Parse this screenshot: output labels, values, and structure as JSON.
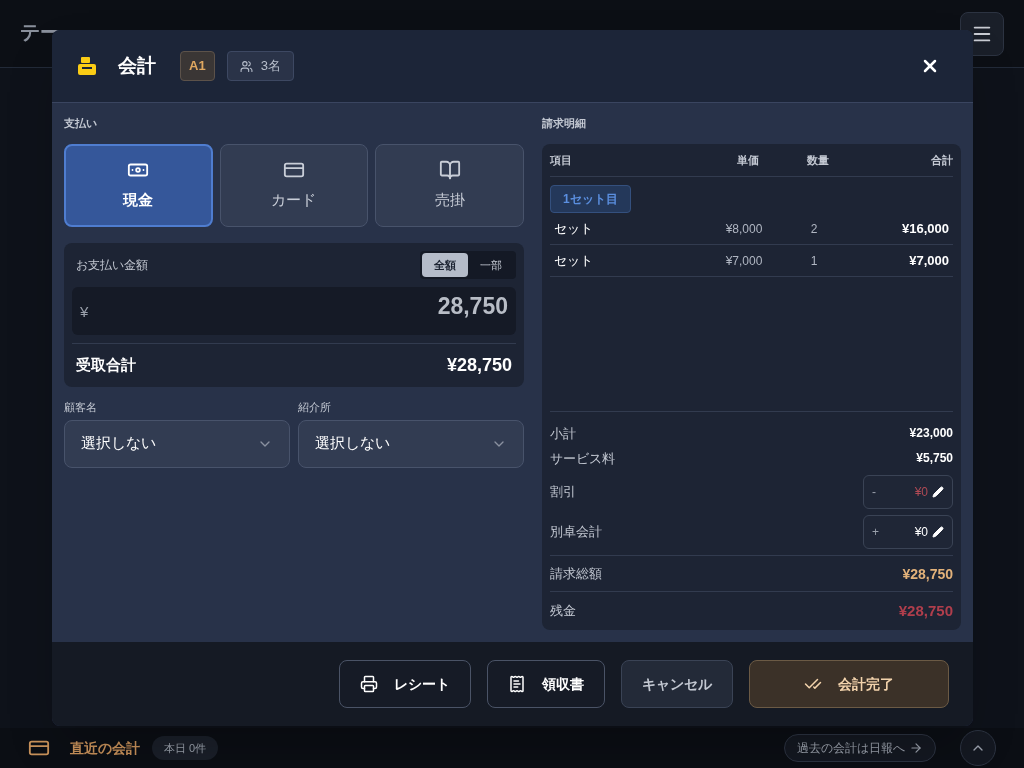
{
  "app_header": {
    "title": "テー"
  },
  "modal": {
    "title": "会計",
    "table_badge": "A1",
    "guests": "3名",
    "payment": {
      "heading": "支払い",
      "methods": [
        {
          "label": "現金",
          "kind": "cash",
          "selected": true
        },
        {
          "label": "カード",
          "kind": "card",
          "selected": false
        },
        {
          "label": "売掛",
          "kind": "credit",
          "selected": false
        }
      ],
      "amount_label": "お支払い金額",
      "amount_modes": [
        {
          "label": "全額",
          "selected": true
        },
        {
          "label": "一部",
          "selected": false
        }
      ],
      "currency": "¥",
      "amount_value": "28,750",
      "received_label": "受取合計",
      "received_value": "¥28,750"
    },
    "customer": {
      "label": "顧客名",
      "value": "選択しない"
    },
    "referrer": {
      "label": "紹介所",
      "value": "選択しない"
    },
    "bill": {
      "heading": "請求明細",
      "columns": [
        "項目",
        "単価",
        "数量",
        "合計"
      ],
      "group_tag": "1セット目",
      "rows": [
        {
          "item": "セット",
          "unit_price": "¥8,000",
          "qty": "2",
          "total": "¥16,000"
        },
        {
          "item": "セット",
          "unit_price": "¥7,000",
          "qty": "1",
          "total": "¥7,000"
        }
      ],
      "subtotal_label": "小計",
      "subtotal": "¥23,000",
      "service_label": "サービス料",
      "service": "¥5,750",
      "adjustments": [
        {
          "label": "割引",
          "sign": "-",
          "value": "¥0",
          "kind": "minus"
        },
        {
          "label": "別卓会計",
          "sign": "+",
          "value": "¥0",
          "kind": "plus"
        }
      ],
      "total_label": "請求総額",
      "total": "¥28,750",
      "balance_label": "残金",
      "balance": "¥28,750"
    },
    "buttons": [
      {
        "label": "レシート",
        "kind": "receipt"
      },
      {
        "label": "領収書",
        "kind": "invoice"
      },
      {
        "label": "キャンセル",
        "kind": "cancel"
      },
      {
        "label": "会計完了",
        "kind": "complete"
      }
    ]
  },
  "footer": {
    "title": "直近の会計",
    "count": "本日 0件",
    "link": "過去の会計は日報へ"
  }
}
